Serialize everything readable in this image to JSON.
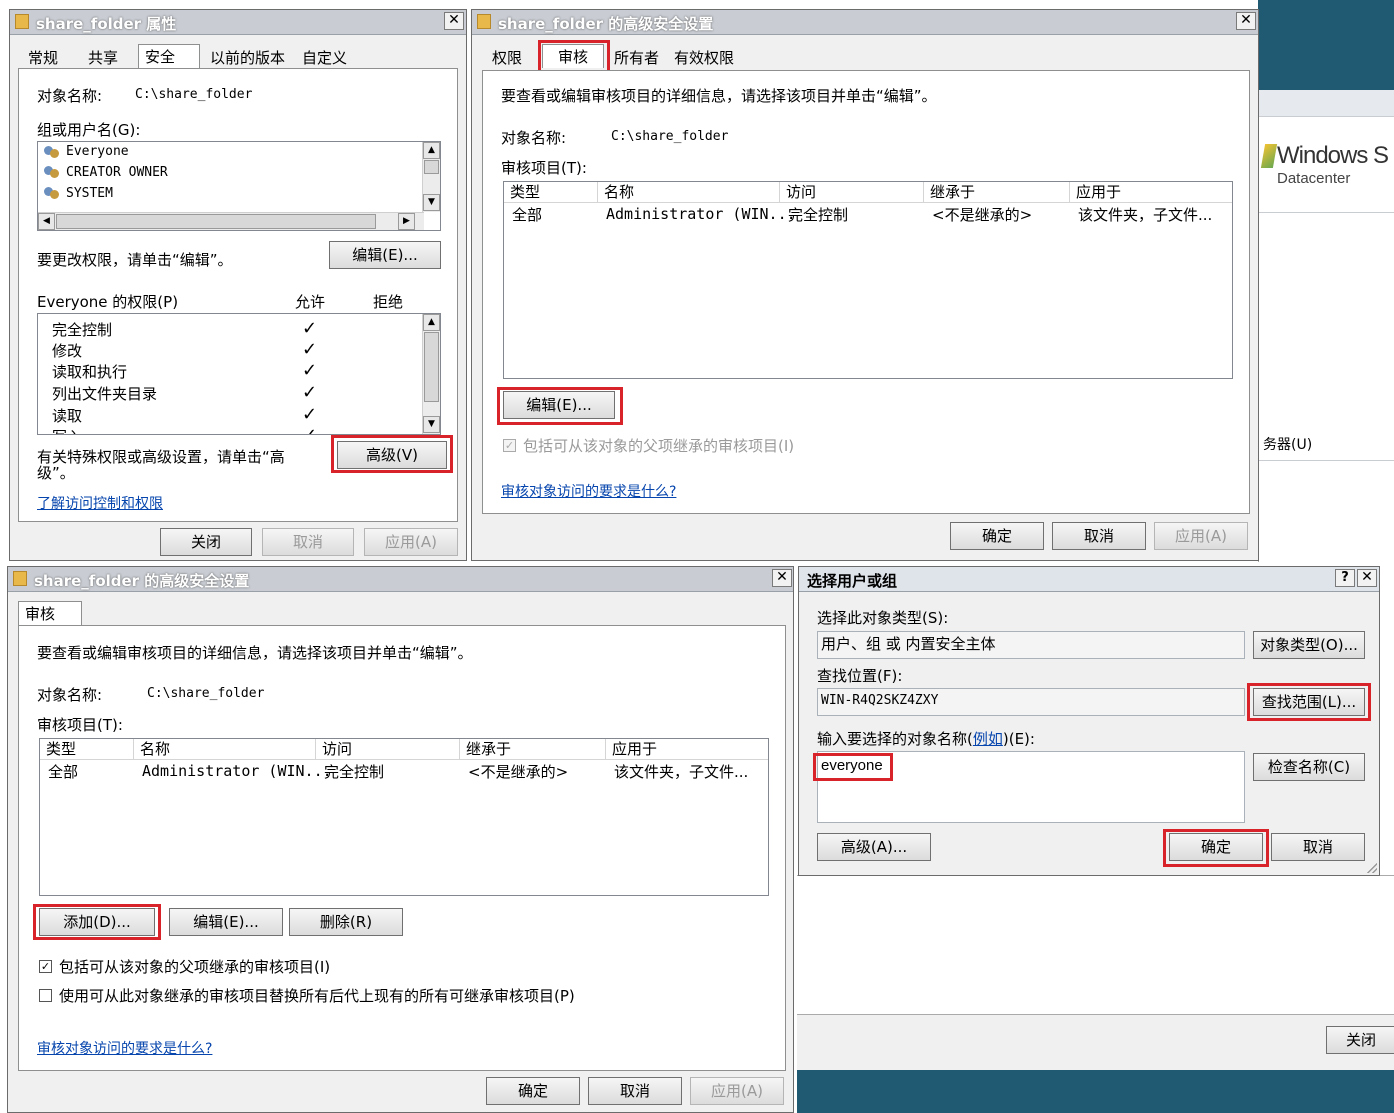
{
  "props": {
    "title": "share_folder 属性",
    "tabs": [
      "常规",
      "共享",
      "安全",
      "以前的版本",
      "自定义"
    ],
    "object_name_label": "对象名称:",
    "object_name_value": "C:\\share_folder",
    "group_label": "组或用户名(G):",
    "users": [
      "Everyone",
      "CREATOR OWNER",
      "SYSTEM"
    ],
    "change_text": "要更改权限，请单击“编辑”。",
    "edit_btn": "编辑(E)...",
    "perm_label": "Everyone 的权限(P)",
    "allow": "允许",
    "deny": "拒绝",
    "permissions": [
      "完全控制",
      "修改",
      "读取和执行",
      "列出文件夹目录",
      "读取",
      "写入"
    ],
    "special_text_1": "有关特殊权限或高级设置，请单击“高",
    "special_text_2": "级”。",
    "advanced_btn": "高级(V)",
    "learn_link": "了解访问控制和权限",
    "close_btn": "关闭",
    "cancel_btn": "取消",
    "apply_btn": "应用(A)"
  },
  "adv1": {
    "title": "share_folder 的高级安全设置",
    "tabs": [
      "权限",
      "审核",
      "所有者",
      "有效权限"
    ],
    "info": "要查看或编辑审核项目的详细信息，请选择该项目并单击“编辑”。",
    "object_name_label": "对象名称:",
    "object_name_value": "C:\\share_folder",
    "entries_label": "审核项目(T):",
    "columns": [
      "类型",
      "名称",
      "访问",
      "继承于",
      "应用于"
    ],
    "row": [
      "全部",
      "Administrator (WIN...",
      "完全控制",
      "<不是继承的>",
      "该文件夹，子文件..."
    ],
    "edit_btn": "编辑(E)...",
    "include_text": "包括可从该对象的父项继承的审核项目(I)",
    "link": "审核对象访问的要求是什么?",
    "ok_btn": "确定",
    "cancel_btn": "取消",
    "apply_btn": "应用(A)"
  },
  "adv2": {
    "title": "share_folder 的高级安全设置",
    "tab": "审核",
    "info": "要查看或编辑审核项目的详细信息，请选择该项目并单击“编辑”。",
    "object_name_label": "对象名称:",
    "object_name_value": "C:\\share_folder",
    "entries_label": "审核项目(T):",
    "columns": [
      "类型",
      "名称",
      "访问",
      "继承于",
      "应用于"
    ],
    "row": [
      "全部",
      "Administrator (WIN...",
      "完全控制",
      "<不是继承的>",
      "该文件夹，子文件..."
    ],
    "add_btn": "添加(D)...",
    "edit_btn": "编辑(E)...",
    "remove_btn": "删除(R)",
    "include_text": "包括可从该对象的父项继承的审核项目(I)",
    "replace_text": "使用可从此对象继承的审核项目替换所有后代上现有的所有可继承审核项目(P)",
    "link": "审核对象访问的要求是什么?",
    "ok_btn": "确定",
    "cancel_btn": "取消",
    "apply_btn": "应用(A)"
  },
  "select": {
    "title": "选择用户或组",
    "help": "?",
    "obj_type_label": "选择此对象类型(S):",
    "obj_type_value": "用户、组 或 内置安全主体",
    "obj_type_btn": "对象类型(O)...",
    "location_label": "查找位置(F):",
    "location_value": "WIN-R4Q2SKZ4ZXY",
    "location_btn": "查找范围(L)...",
    "enter_label_pre": "输入要选择的对象名称(",
    "enter_label_link": "例如",
    "enter_label_post": ")(E):",
    "name_value": "everyone",
    "check_btn": "检查名称(C)",
    "advanced_btn": "高级(A)...",
    "ok_btn": "确定",
    "cancel_btn": "取消"
  },
  "background": {
    "windows_brand": "Windows S",
    "datacenter": "Datacenter",
    "server_text": "务器(U)",
    "close_btn": "关闭"
  }
}
